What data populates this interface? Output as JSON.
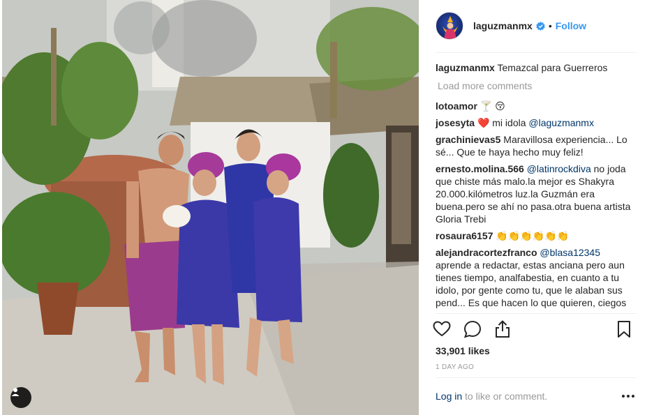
{
  "post": {
    "username": "laguzmanmx",
    "follow_label": "Follow",
    "separator": "•"
  },
  "caption": {
    "username": "laguzmanmx",
    "text": "Temazcal para Guerreros"
  },
  "load_more_label": "Load more comments",
  "comments": [
    {
      "user": "lotoamor",
      "mention": "",
      "text": "🍸 😚"
    },
    {
      "user": "josesyta",
      "mention": "@laguzmanmx",
      "text": "❤️ mi idola"
    },
    {
      "user": "grachinievas5",
      "mention": "",
      "text": "Maravillosa experiencia... Lo sé... Que te haya hecho muy feliz!"
    },
    {
      "user": "ernesto.molina.566",
      "mention": "@latinrockdiva",
      "text": "no joda que chiste más malo.la mejor es Shakyra 20.000.kilómetros luz.la Guzmán era buena.pero se ahí no pasa.otra buena artista Gloria Trebi"
    },
    {
      "user": "rosaura6157",
      "mention": "",
      "text": "👏👏👏👏👏👏"
    },
    {
      "user": "alejandracortezfranco",
      "mention": "@blasa12345",
      "text": "aprende a redactar, estas anciana pero aun tienes tiempo, analfabestia, en cuanto a tu idolo, por gente como tu, que le alaban sus pend... Es que hacen lo que quieren, ciegos"
    }
  ],
  "likes": "33,901 likes",
  "timestamp": "1 DAY AGO",
  "login": {
    "link": "Log in",
    "rest": " to like or comment."
  },
  "colors": {
    "accent": "#3897f0",
    "mention": "#003569",
    "muted": "#999999",
    "heart": "#ed4956"
  },
  "icons": [
    "verified-badge-icon",
    "heart-icon",
    "comment-icon",
    "share-icon",
    "bookmark-icon",
    "more-options-icon",
    "user-tag-icon"
  ]
}
